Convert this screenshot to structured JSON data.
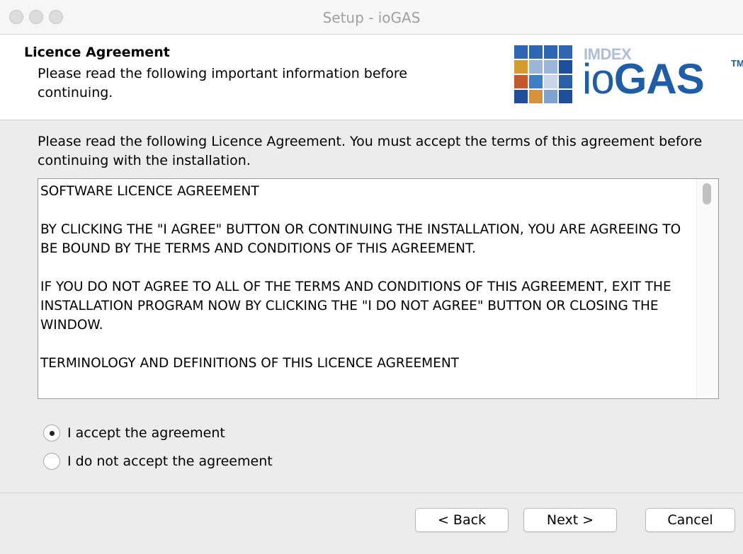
{
  "window": {
    "title": "Setup - ioGAS",
    "traffic_lights": [
      "close",
      "minimize",
      "zoom"
    ]
  },
  "header": {
    "title": "Licence Agreement",
    "subtitle": "Please read the following important information before continuing.",
    "logo": {
      "brand": "IMDEX",
      "product_light": "io",
      "product_bold": "GAS",
      "trademark": "TM",
      "tile_colors": [
        "#2f66b3",
        "#2f66b3",
        "#2f66b3",
        "#2f66b3",
        "#d39a2c",
        "#9bb6d8",
        "#9bb6d8",
        "#1d4e9c",
        "#c4582a",
        "#3e7ec4",
        "#c8d6e8",
        "#2a5ea8",
        "#1d4e9c",
        "#d8913a",
        "#7ea3d0",
        "#1d4e9c"
      ]
    }
  },
  "main": {
    "intro": "Please read the following Licence Agreement. You must accept the terms of this agreement before continuing with the installation.",
    "licence_text": [
      "SOFTWARE LICENCE AGREEMENT",
      "",
      "BY CLICKING THE \"I AGREE\" BUTTON OR CONTINUING THE INSTALLATION, YOU ARE AGREEING TO BE BOUND BY THE TERMS AND CONDITIONS OF THIS AGREEMENT.",
      "",
      "IF YOU DO NOT AGREE TO ALL OF THE TERMS AND CONDITIONS OF THIS AGREEMENT, EXIT THE INSTALLATION PROGRAM NOW BY CLICKING THE \"I DO NOT AGREE\" BUTTON OR CLOSING THE WINDOW.",
      "",
      "TERMINOLOGY AND DEFINITIONS OF THIS LICENCE AGREEMENT"
    ],
    "options": {
      "accept": {
        "label": "I accept the agreement",
        "selected": true
      },
      "decline": {
        "label": "I do not accept the agreement",
        "selected": false
      }
    }
  },
  "footer": {
    "back_label": "< Back",
    "next_label": "Next >",
    "cancel_label": "Cancel"
  }
}
